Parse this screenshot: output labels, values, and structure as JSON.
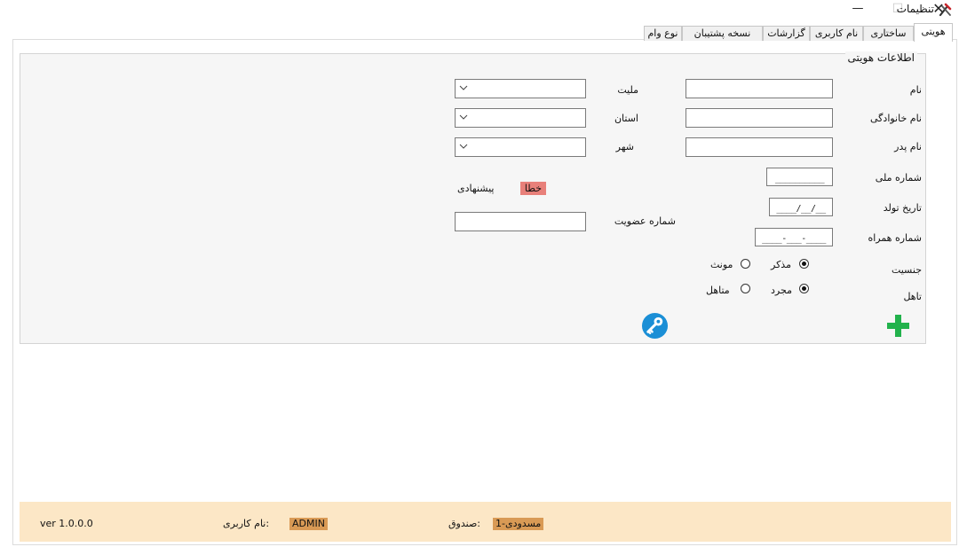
{
  "window": {
    "title": "تنظیمات",
    "minimize_glyph": "—",
    "maximize_glyph": "☐",
    "close_glyph": "✕"
  },
  "tabs": [
    {
      "label": "هویتی",
      "active": true
    },
    {
      "label": "ساختاری",
      "active": false
    },
    {
      "label": "نام کاربری",
      "active": false
    },
    {
      "label": "گزارشات",
      "active": false
    },
    {
      "label": "نسخه پشتیبان",
      "active": false
    },
    {
      "label": "نوع وام",
      "active": false
    }
  ],
  "identity_group": {
    "title": "اطلاعات هویتی",
    "fields": {
      "first_name": {
        "label": "نام",
        "value": ""
      },
      "last_name": {
        "label": "نام خانوادگی",
        "value": ""
      },
      "father_name": {
        "label": "نام پدر",
        "value": ""
      },
      "national_code": {
        "label": "شماره ملی",
        "mask": "__________"
      },
      "birth_date": {
        "label": "تاریخ تولد",
        "mask": "____/__/__"
      },
      "mobile": {
        "label": "شماره همراه",
        "mask": "____-___-____"
      },
      "nationality": {
        "label": "ملیت",
        "value": ""
      },
      "province": {
        "label": "استان",
        "value": ""
      },
      "city": {
        "label": "شهر",
        "value": ""
      },
      "membership_number": {
        "label": "شماره عضویت",
        "value": ""
      }
    },
    "suggestion_label": "پیشنهادی",
    "error_label": "خطا",
    "gender": {
      "label": "جنسیت",
      "options": [
        "مذکر",
        "مونث"
      ],
      "selected": "مذکر"
    },
    "marital": {
      "label": "تاهل",
      "options": [
        "مجرد",
        "متاهل"
      ],
      "selected": "مجرد"
    },
    "icons": {
      "add": "plus-icon",
      "key": "key-icon"
    },
    "colors": {
      "add": "#22b24c",
      "key": "#1b8fd6",
      "error": "#e8807a"
    }
  },
  "statusbar": {
    "fund_label": "صندوق:",
    "fund_value": "1-مسدودی",
    "user_label": "نام کاربری:",
    "user_value": "ADMIN",
    "version": "ver 1.0.0.0",
    "background": "#fce7c6",
    "badge_color": "#d99a55"
  }
}
